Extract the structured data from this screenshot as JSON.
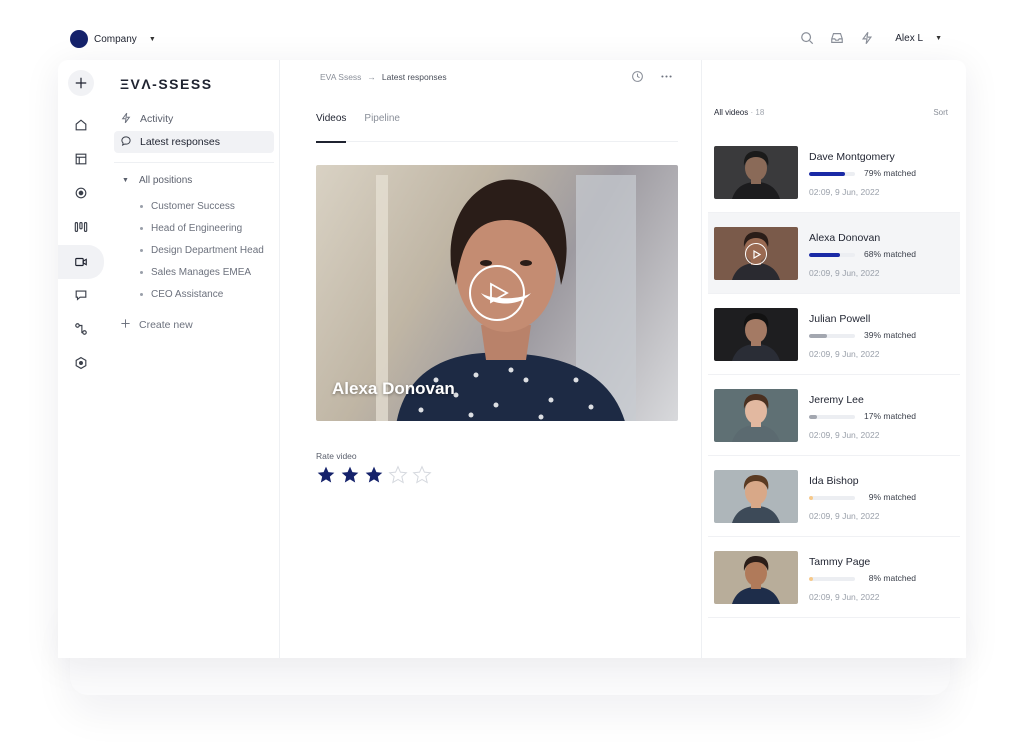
{
  "header": {
    "company_name": "Company",
    "user_name": "Alex L",
    "icons": [
      "search-icon",
      "inbox-icon",
      "lightning-icon"
    ]
  },
  "rail": {
    "icons": [
      "plus-icon",
      "home-icon",
      "layout-icon",
      "compass-icon",
      "columns-icon",
      "video-icon",
      "chat-icon",
      "workflow-icon",
      "hexagon-icon"
    ],
    "active": "video-icon"
  },
  "sidebar": {
    "logo": "ΞVΛ-SSESS",
    "items": [
      {
        "label": "Activity",
        "icon": "lightning-icon"
      },
      {
        "label": "Latest responses",
        "icon": "chat-icon",
        "active": true
      }
    ],
    "positions_label": "All positions",
    "positions": [
      "Customer Success",
      "Head of Engineering",
      "Design Department Head",
      "Sales Manages EMEA",
      "CEO Assistance"
    ],
    "create_label": "Create new"
  },
  "main": {
    "breadcrumb": [
      "EVA Ssess",
      "Latest responses"
    ],
    "tabs": [
      {
        "label": "Videos",
        "active": true
      },
      {
        "label": "Pipeline",
        "active": false
      }
    ],
    "video_name": "Alexa Donovan",
    "rate_label": "Rate video",
    "rating": 3,
    "rating_max": 5
  },
  "videos": {
    "title": "All videos",
    "count_text": "· 18",
    "sort_label": "Sort",
    "items": [
      {
        "name": "Dave Montgomery",
        "match_text": "79% matched",
        "match": 0.79,
        "time": "02:09, 9 Jun, 2022",
        "color": "#1a2aa6"
      },
      {
        "name": "Alexa Donovan",
        "match_text": "68% matched",
        "match": 0.68,
        "time": "02:09, 9 Jun, 2022",
        "color": "#1a2aa6",
        "active": true
      },
      {
        "name": "Julian Powell",
        "match_text": "39% matched",
        "match": 0.39,
        "time": "02:09, 9 Jun, 2022",
        "color": "#a3a7b0"
      },
      {
        "name": "Jeremy Lee",
        "match_text": "17% matched",
        "match": 0.17,
        "time": "02:09, 9 Jun, 2022",
        "color": "#a3a7b0"
      },
      {
        "name": "Ida Bishop",
        "match_text": "9% matched",
        "match": 0.09,
        "time": "02:09, 9 Jun, 2022",
        "color": "#f7c98a"
      },
      {
        "name": "Tammy Page",
        "match_text": "8% matched",
        "match": 0.08,
        "time": "02:09, 9 Jun, 2022",
        "color": "#f7c98a"
      }
    ]
  },
  "colors": {
    "accent": "#15226b",
    "star_filled": "#15226b",
    "star_empty": "#d5d8de"
  }
}
